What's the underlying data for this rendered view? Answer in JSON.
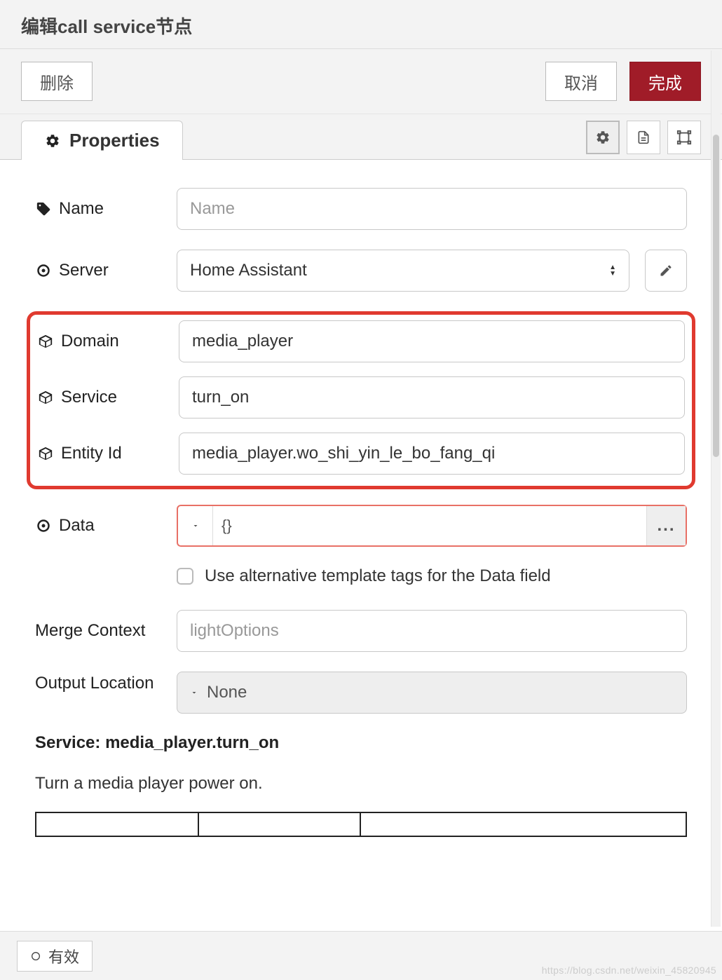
{
  "header": {
    "title": "编辑call service节点"
  },
  "buttons": {
    "delete": "删除",
    "cancel": "取消",
    "done": "完成"
  },
  "tabs": {
    "properties": "Properties"
  },
  "form": {
    "name": {
      "label": "Name",
      "value": "",
      "placeholder": "Name"
    },
    "server": {
      "label": "Server",
      "value": "Home Assistant"
    },
    "domain": {
      "label": "Domain",
      "value": "media_player"
    },
    "service": {
      "label": "Service",
      "value": "turn_on"
    },
    "entity_id": {
      "label": "Entity Id",
      "value": "media_player.wo_shi_yin_le_bo_fang_qi"
    },
    "data": {
      "label": "Data",
      "type_hint": "{}",
      "expand": "..."
    },
    "data_alt_checkbox": "Use alternative template tags for the Data field",
    "merge_context": {
      "label": "Merge Context",
      "value": "",
      "placeholder": "lightOptions"
    },
    "output_location": {
      "label": "Output Location",
      "value": "None"
    }
  },
  "doc": {
    "heading": "Service: media_player.turn_on",
    "description": "Turn a media player power on."
  },
  "footer": {
    "status": "有效"
  },
  "watermark": "https://blog.csdn.net/weixin_45820945"
}
